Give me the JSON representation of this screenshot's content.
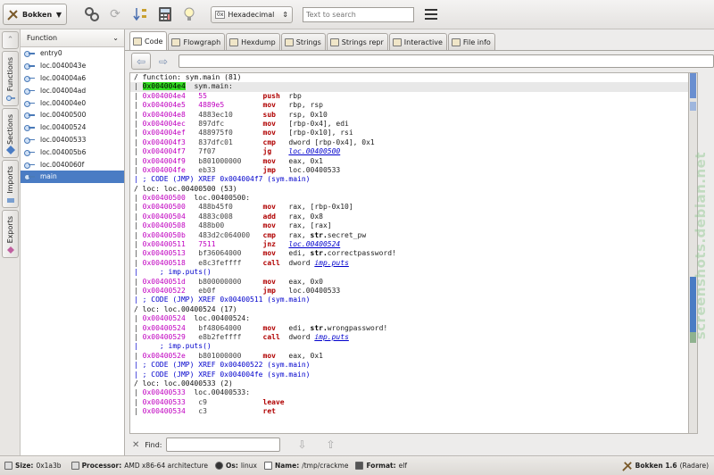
{
  "toolbar": {
    "app_name": "Bokken",
    "mode": "Hexadecimal",
    "mode_prefix": "0x",
    "search_placeholder": "Text to search"
  },
  "side_tabs": [
    "Functions",
    "Sections",
    "Imports",
    "Exports"
  ],
  "functions": {
    "header": "Function",
    "items": [
      "entry0",
      "loc.0040043e",
      "loc.004004a6",
      "loc.004004ad",
      "loc.004004e0",
      "loc.00400500",
      "loc.00400524",
      "loc.00400533",
      "loc.004005b6",
      "loc.0040060f",
      "main"
    ],
    "selected": "main"
  },
  "tabs": [
    "Code",
    "Flowgraph",
    "Hexdump",
    "Strings",
    "Strings repr",
    "Interactive",
    "File info"
  ],
  "active_tab": "Code",
  "code_lines": [
    {
      "t": "hdr",
      "text": "/ function: sym.main (81)"
    },
    {
      "t": "lbl",
      "addr": "0x004004e4",
      "label": "sym.main:",
      "hl": true
    },
    {
      "t": "ins",
      "addr": "0x004004e4",
      "hex": "55",
      "hm": true,
      "mn": "push",
      "ops": "rbp"
    },
    {
      "t": "ins",
      "addr": "0x004004e5",
      "hex": "4889e5",
      "hm": true,
      "mn": "mov",
      "ops": "rbp, rsp"
    },
    {
      "t": "ins",
      "addr": "0x004004e8",
      "hex": "4883ec10",
      "mn": "sub",
      "ops": "rsp, 0x10"
    },
    {
      "t": "ins",
      "addr": "0x004004ec",
      "hex": "897dfc",
      "mn": "mov",
      "ops": "[rbp-0x4], edi"
    },
    {
      "t": "ins",
      "addr": "0x004004ef",
      "hex": "488975f0",
      "mn": "mov",
      "ops": "[rbp-0x10], rsi"
    },
    {
      "t": "ins",
      "addr": "0x004004f3",
      "hex": "837dfc01",
      "mn": "cmp",
      "ops": "dword [rbp-0x4], 0x1"
    },
    {
      "t": "ins",
      "addr": "0x004004f7",
      "hex": "7f07",
      "mn": "jg",
      "link": "loc.00400500"
    },
    {
      "t": "ins",
      "addr": "0x004004f9",
      "hex": "b801000000",
      "mn": "mov",
      "ops": "eax, 0x1"
    },
    {
      "t": "ins",
      "addr": "0x004004fe",
      "hex": "eb33",
      "mn": "jmp",
      "ops": "loc.00400533"
    },
    {
      "t": "cmt",
      "text": "| ; CODE (JMP) XREF 0x004004f7 (sym.main)"
    },
    {
      "t": "hdr",
      "text": "/ loc: loc.00400500 (53)"
    },
    {
      "t": "lbl",
      "addr": "0x00400500",
      "label": "loc.00400500:"
    },
    {
      "t": "ins",
      "addr": "0x00400500",
      "hex": "488b45f0",
      "mn": "mov",
      "ops": "rax, [rbp-0x10]"
    },
    {
      "t": "ins",
      "addr": "0x00400504",
      "hex": "4883c008",
      "mn": "add",
      "ops": "rax, 0x8"
    },
    {
      "t": "ins",
      "addr": "0x00400508",
      "hex": "488b00",
      "mn": "mov",
      "ops": "rax, [rax]"
    },
    {
      "t": "ins",
      "addr": "0x0040050b",
      "hex": "483d2c064000",
      "mn": "cmp",
      "ops": "rax, ",
      "kw": "str.",
      "tail": "secret_pw"
    },
    {
      "t": "ins",
      "addr": "0x00400511",
      "hex": "7511",
      "hm": true,
      "mn": "jnz",
      "link": "loc.00400524"
    },
    {
      "t": "ins",
      "addr": "0x00400513",
      "hex": "bf36064000",
      "mn": "mov",
      "ops": "edi, ",
      "kw": "str.",
      "tail": "correctpassword!"
    },
    {
      "t": "ins",
      "addr": "0x00400518",
      "hex": "e8c3feffff",
      "mn": "call",
      "ops": "dword ",
      "link": "imp.puts"
    },
    {
      "t": "cmt",
      "text": "|     ; imp.puts()"
    },
    {
      "t": "ins",
      "addr": "0x0040051d",
      "hex": "b800000000",
      "mn": "mov",
      "ops": "eax, 0x0"
    },
    {
      "t": "ins",
      "addr": "0x00400522",
      "hex": "eb0f",
      "mn": "jmp",
      "ops": "loc.00400533"
    },
    {
      "t": "cmt",
      "text": "| ; CODE (JMP) XREF 0x00400511 (sym.main)"
    },
    {
      "t": "hdr",
      "text": "/ loc: loc.00400524 (17)"
    },
    {
      "t": "lbl",
      "addr": "0x00400524",
      "label": "loc.00400524:"
    },
    {
      "t": "ins",
      "addr": "0x00400524",
      "hex": "bf48064000",
      "mn": "mov",
      "ops": "edi, ",
      "kw": "str.",
      "tail": "wrongpassword!"
    },
    {
      "t": "ins",
      "addr": "0x00400529",
      "hex": "e8b2feffff",
      "mn": "call",
      "ops": "dword ",
      "link": "imp.puts"
    },
    {
      "t": "cmt",
      "text": "|     ; imp.puts()"
    },
    {
      "t": "ins",
      "addr": "0x0040052e",
      "hex": "b801000000",
      "mn": "mov",
      "ops": "eax, 0x1"
    },
    {
      "t": "cmt",
      "text": "| ; CODE (JMP) XREF 0x00400522 (sym.main)"
    },
    {
      "t": "cmt",
      "text": "| ; CODE (JMP) XREF 0x004004fe (sym.main)"
    },
    {
      "t": "hdr",
      "text": "/ loc: loc.00400533 (2)"
    },
    {
      "t": "lbl",
      "addr": "0x00400533",
      "label": "loc.00400533:"
    },
    {
      "t": "ins",
      "addr": "0x00400533",
      "hex": "c9",
      "mn": "leave",
      "ops": ""
    },
    {
      "t": "ins",
      "addr": "0x00400534",
      "hex": "c3",
      "mn": "ret",
      "ops": ""
    }
  ],
  "find": {
    "label": "Find:"
  },
  "status": {
    "size_label": "Size:",
    "size": "0x1a3b",
    "processor_label": "Processor:",
    "processor": "AMD x86-64 architecture",
    "os_label": "Os:",
    "os": "linux",
    "name_label": "Name:",
    "name": "/tmp/crackme",
    "format_label": "Format:",
    "format": "elf",
    "app_title": "Bokken 1.6",
    "app_sub": "(Radare)"
  },
  "watermark": "screenshots.debian.net",
  "colors": {
    "accent": "#4a7cc4",
    "address": "#c000c0",
    "mnemonic": "#b00000",
    "highlight": "#33dd22",
    "xref": "#0000cc"
  }
}
